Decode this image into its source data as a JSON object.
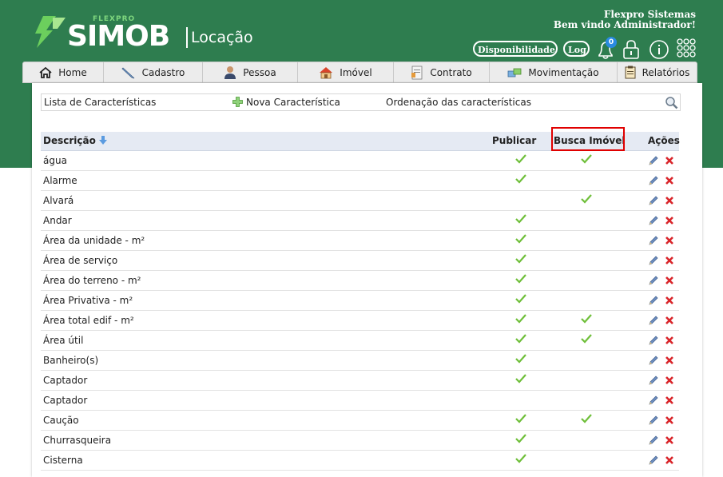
{
  "header": {
    "logo_small": "FLEXPRO",
    "logo_main": "SIMOB",
    "logo_sub": "Locação",
    "company_name": "Flexpro Sistemas",
    "welcome": "Bem vindo Administrador!",
    "availability_button": "Disponibilidade",
    "log_button": "Log",
    "notification_count": "0",
    "icons": [
      "bell-icon",
      "lock-icon",
      "info-icon",
      "apps-grid-icon"
    ]
  },
  "menu": [
    {
      "label": "Home",
      "icon": "home-icon"
    },
    {
      "label": "Cadastro",
      "icon": "pen-icon"
    },
    {
      "label": "Pessoa",
      "icon": "person-icon"
    },
    {
      "label": "Imóvel",
      "icon": "house-icon"
    },
    {
      "label": "Contrato",
      "icon": "contract-icon"
    },
    {
      "label": "Movimentação",
      "icon": "transfer-icon"
    },
    {
      "label": "Relatórios",
      "icon": "report-icon"
    }
  ],
  "subbar": {
    "list_label": "Lista de Características",
    "new_label": "Nova Característica",
    "order_label": "Ordenação das características"
  },
  "table": {
    "col_description": "Descrição",
    "col_publish": "Publicar",
    "col_search": "Busca Imóvel",
    "col_actions": "Ações",
    "rows": [
      {
        "description": "água",
        "publicar": true,
        "busca": true
      },
      {
        "description": "Alarme",
        "publicar": true,
        "busca": false
      },
      {
        "description": "Alvará",
        "publicar": false,
        "busca": true
      },
      {
        "description": "Andar",
        "publicar": true,
        "busca": false
      },
      {
        "description": "Área da unidade - m²",
        "publicar": true,
        "busca": false
      },
      {
        "description": "Área de serviço",
        "publicar": true,
        "busca": false
      },
      {
        "description": "Área do terreno - m²",
        "publicar": true,
        "busca": false
      },
      {
        "description": "Área Privativa - m²",
        "publicar": true,
        "busca": false
      },
      {
        "description": "Área total edif - m²",
        "publicar": true,
        "busca": true
      },
      {
        "description": "Área útil",
        "publicar": true,
        "busca": true
      },
      {
        "description": "Banheiro(s)",
        "publicar": true,
        "busca": false
      },
      {
        "description": "Captador",
        "publicar": true,
        "busca": false
      },
      {
        "description": "Captador",
        "publicar": false,
        "busca": false
      },
      {
        "description": "Caução",
        "publicar": true,
        "busca": true
      },
      {
        "description": "Churrasqueira",
        "publicar": true,
        "busca": false
      },
      {
        "description": "Cisterna",
        "publicar": true,
        "busca": false
      }
    ]
  },
  "colors": {
    "brand_green": "#2e7d4f",
    "highlight_red": "#e00000",
    "check_green": "#6fbf3a",
    "delete_red": "#d9252a"
  }
}
